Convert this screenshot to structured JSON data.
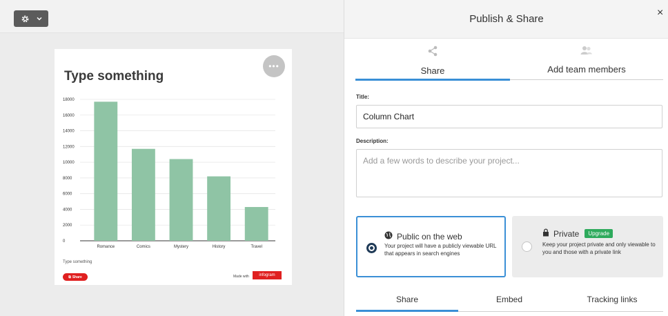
{
  "toolbar": {
    "settings_icon": "gear-icon",
    "chevron_icon": "chevron-down-icon"
  },
  "card": {
    "title": "Type something",
    "caption": "Type something",
    "share_button": "Share",
    "made_with": "Made with",
    "brand": "infogram"
  },
  "chart_data": {
    "type": "bar",
    "title": "Type something",
    "categories": [
      "Romance",
      "Comics",
      "Mystery",
      "History",
      "Travel"
    ],
    "series": [
      {
        "values": [
          17700,
          11700,
          10400,
          8200,
          4300
        ]
      }
    ],
    "ylim": [
      0,
      18000
    ],
    "yticks": [
      "0",
      "2000",
      "4000",
      "6000",
      "8000",
      "10000",
      "12000",
      "14000",
      "16000",
      "18000"
    ],
    "grid": true,
    "bar_color": "#8fc4a5"
  },
  "panel": {
    "header_title": "Publish & Share",
    "close_glyph": "×",
    "tabs": [
      {
        "label": "Share",
        "icon": "share-icon"
      },
      {
        "label": "Add team members",
        "icon": "users-icon"
      }
    ],
    "title_label": "Title:",
    "title_value": "Column Chart",
    "description_label": "Description:",
    "description_placeholder": "Add a few words to describe your project...",
    "public_option": {
      "title": "Public on the web",
      "description": "Your project will have a publicly viewable URL that appears in search engines"
    },
    "private_option": {
      "title": "Private",
      "badge": "Upgrade",
      "description": "Keep your project private and only viewable to you and those with a private link"
    },
    "bottom_tabs": [
      "Share",
      "Embed",
      "Tracking links"
    ]
  },
  "colors": {
    "accent": "#3a8fd6",
    "brand_red": "#e02020",
    "upgrade_green": "#2eaa5c"
  }
}
